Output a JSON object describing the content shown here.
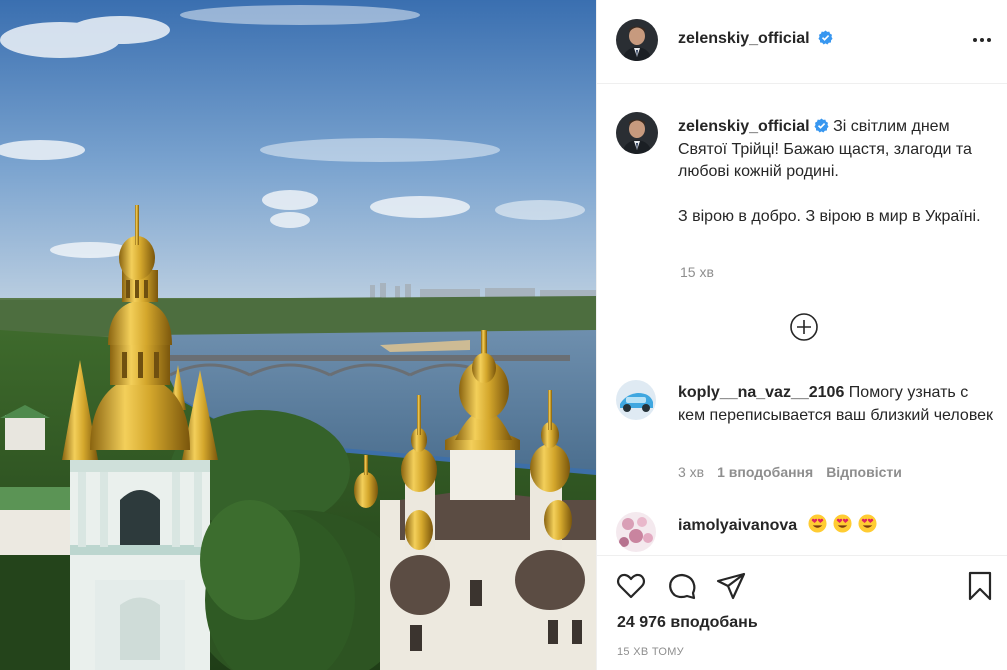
{
  "post": {
    "username": "zelenskiy_official",
    "caption_p1": "Зі світлим днем Святої Трійці! Бажаю щастя, злагоди та любові кожній родині.",
    "caption_p2": "З вірою в добро. З вірою в мир в Україні.",
    "caption_time": "15 хв",
    "likes": "24 976 вподобань",
    "time_ago": "15 ХВ ТОМУ"
  },
  "comments": [
    {
      "username": "koply__na_vaz__2106",
      "text": "Помогу узнать с кем переписывается ваш близкий человек",
      "time": "3 хв",
      "likes": "1 вподобання",
      "reply": "Відповісти"
    },
    {
      "username": "iamolyaivanova",
      "emojis": [
        "heart-eyes-emoji",
        "heart-eyes-emoji",
        "heart-eyes-emoji"
      ]
    }
  ],
  "icons": {
    "verified": "verified-badge-icon",
    "more": "more-options-icon",
    "load_more": "plus-circle-icon",
    "like": "heart-icon",
    "comment": "comment-icon",
    "share": "send-icon",
    "save": "bookmark-icon"
  },
  "colors": {
    "verified": "#3897f0",
    "muted_text": "#8e8e8e",
    "text": "#262626",
    "divider": "#efefef",
    "gold": "#d4a72c"
  }
}
